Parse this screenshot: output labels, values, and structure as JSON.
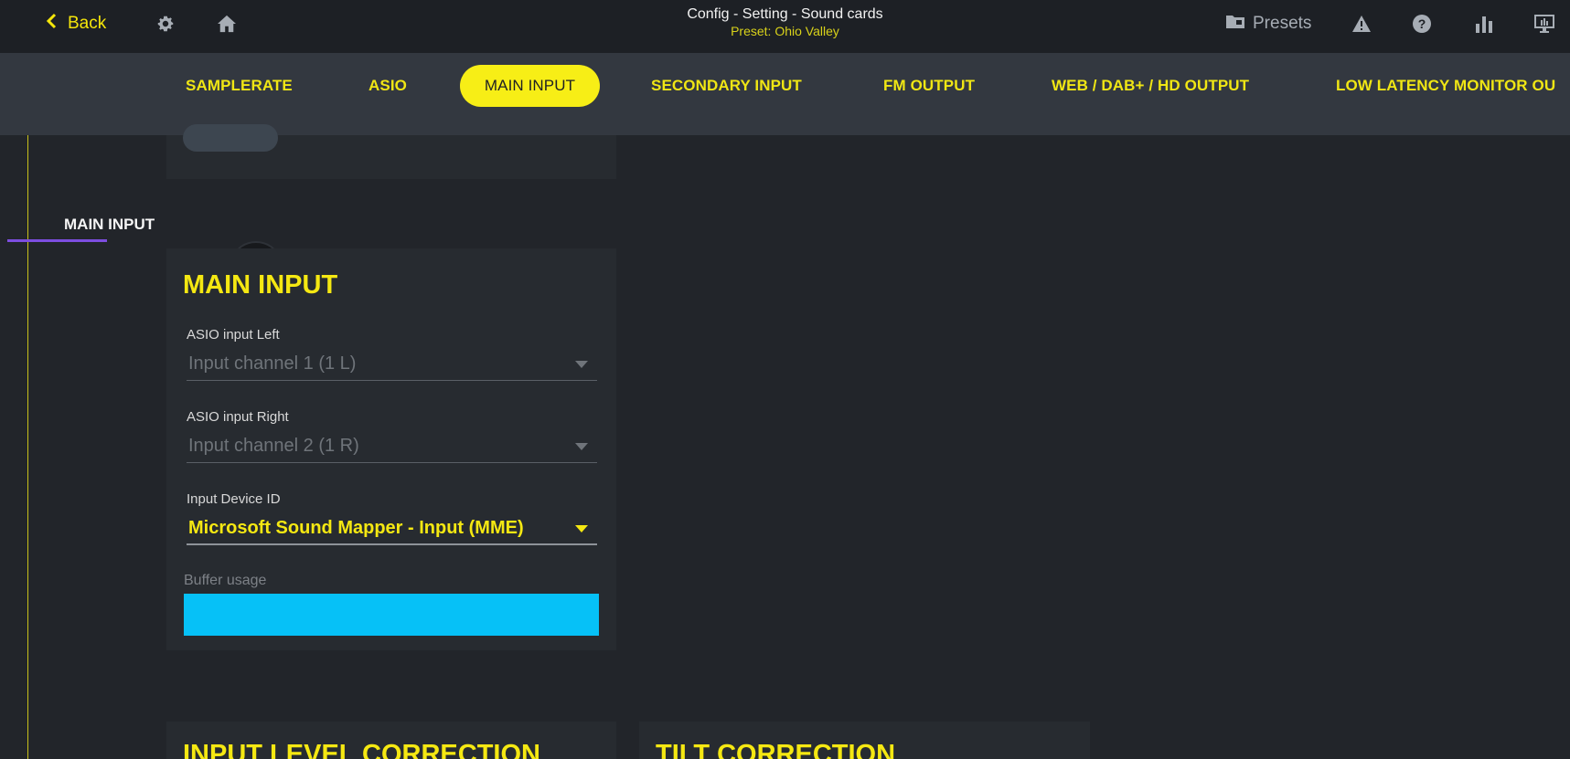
{
  "topbar": {
    "back_label": "Back",
    "title": "Config - Setting - Sound cards",
    "preset": "Preset: Ohio Valley",
    "presets_label": "Presets",
    "icons": [
      "settings-icon",
      "home-icon",
      "folder-icon",
      "warning-icon",
      "help-icon",
      "bar-chart-icon",
      "monitor-icon"
    ]
  },
  "tabs": [
    {
      "label": "SAMPLERATE"
    },
    {
      "label": "ASIO"
    },
    {
      "label": "MAIN INPUT",
      "active": true
    },
    {
      "label": "SECONDARY INPUT"
    },
    {
      "label": "FM OUTPUT"
    },
    {
      "label": "WEB / DAB+ / HD OUTPUT"
    },
    {
      "label": "LOW LATENCY MONITOR OU"
    }
  ],
  "side": {
    "section_label": "MAIN INPUT"
  },
  "main_input": {
    "title": "MAIN INPUT",
    "asio_left_label": "ASIO input Left",
    "asio_left_value": "Input channel 1 (1 L)",
    "asio_right_label": "ASIO input Right",
    "asio_right_value": "Input channel 2 (1 R)",
    "device_label": "Input Device ID",
    "device_value": "Microsoft Sound Mapper - Input (MME)",
    "buffer_label": "Buffer usage",
    "buffer_fraction": 1.0
  },
  "lower_panels": {
    "input_level_title": "INPUT LEVEL CORRECTION",
    "tilt_title": "TILT CORRECTION"
  },
  "colors": {
    "accent_yellow": "#f5e812",
    "buffer_blue": "#06c1f7",
    "section_underline": "#7d4ee0",
    "background": "#22252a"
  }
}
